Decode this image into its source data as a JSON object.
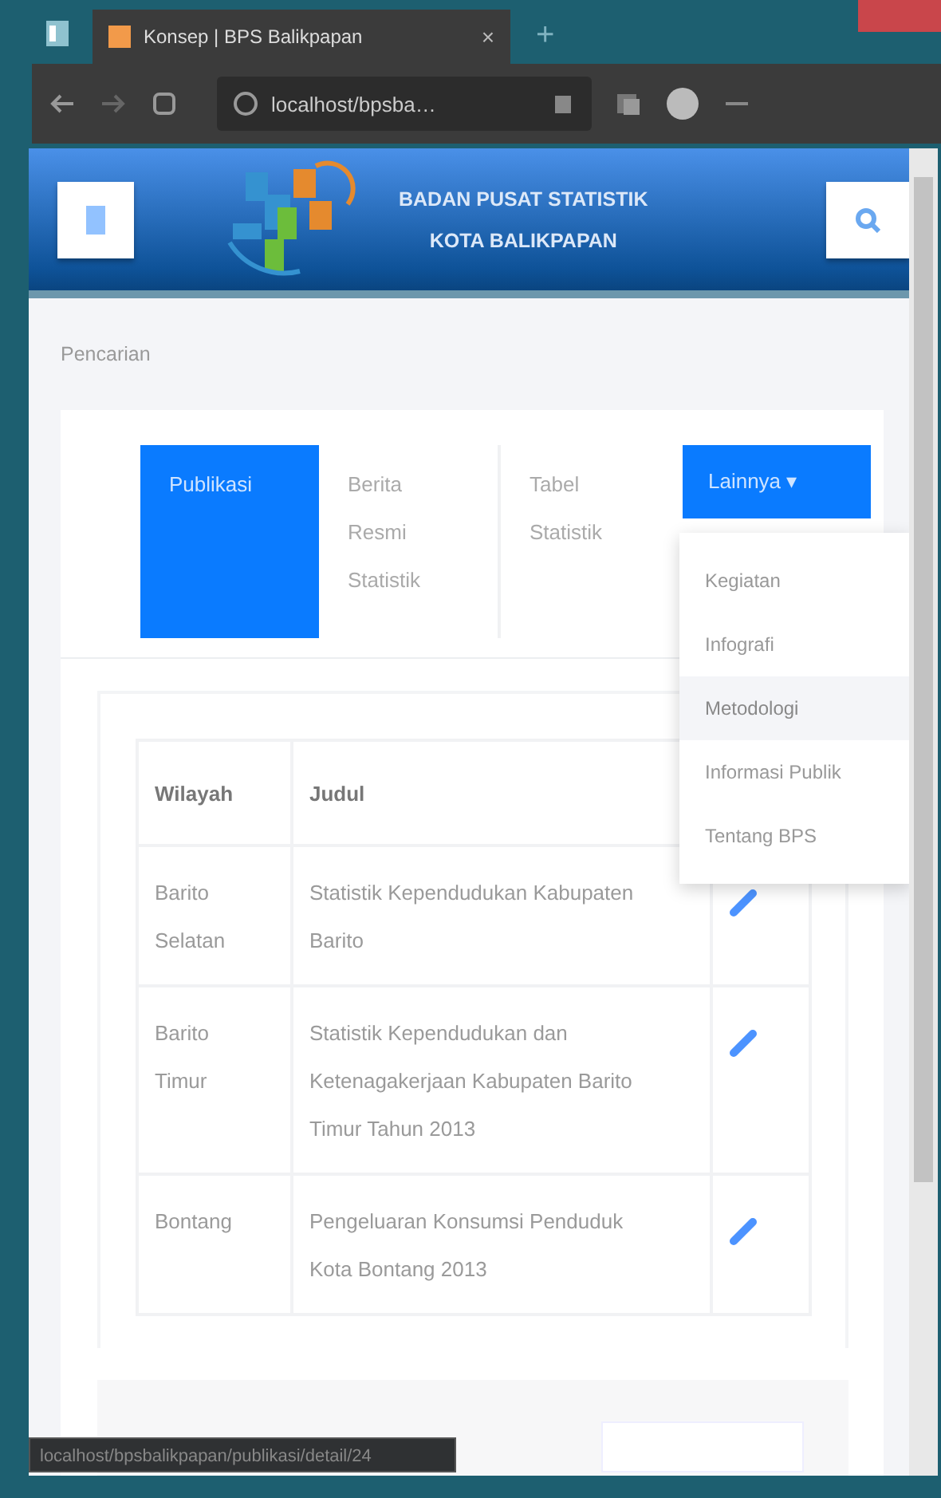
{
  "browser": {
    "tab_title": "Konsep | BPS Balikpapan",
    "tab_close": "×",
    "new_tab": "+",
    "address": "localhost/bpsba…",
    "status_url": "localhost/bpsbalikpapan/publikasi/detail/24"
  },
  "header": {
    "title_line_1": "BADAN PUSAT STATISTIK",
    "title_line_2": "KOTA BALIKPAPAN"
  },
  "breadcrumb": "Pencarian",
  "tabs": [
    {
      "label": "Publikasi",
      "kind": "link",
      "selected": true
    },
    {
      "label": "Berita Resmi Statistik",
      "kind": "link",
      "selected": false
    },
    {
      "label": "Tabel Statistik",
      "kind": "link",
      "selected": false
    },
    {
      "label": "Lainnya",
      "kind": "dropdown",
      "expanded": true,
      "caret": "▾"
    }
  ],
  "dropdown": [
    {
      "label": "Kegiatan",
      "selected": false
    },
    {
      "label": "Infografi",
      "selected": false
    },
    {
      "label": "Metodologi",
      "selected": true
    },
    {
      "label": "Informasi Publik",
      "selected": false
    },
    {
      "label": "Tentang BPS",
      "selected": false
    }
  ],
  "table": {
    "columns": [
      "Wilayah",
      "Judul"
    ],
    "rows": [
      {
        "wilayah": "Barito Selatan",
        "judul": "Statistik Kependudukan Kabupaten Barito"
      },
      {
        "wilayah": "Barito Timur",
        "judul": "Statistik Kependudukan dan Ketenagakerjaan Kabupaten Barito Timur Tahun 2013"
      },
      {
        "wilayah": "Bontang",
        "judul": "Pengeluaran Konsumsi Penduduk Kota Bontang 2013"
      }
    ]
  }
}
